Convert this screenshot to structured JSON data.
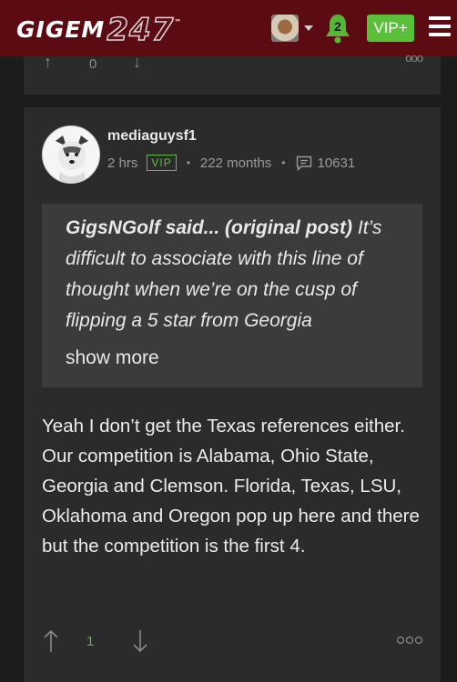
{
  "header": {
    "logo_text": "GIGEM",
    "logo_number": "247",
    "logo_tm": "™",
    "notification_count": "2",
    "vip_label": "VIP+"
  },
  "prev_post": {
    "vote_count": "0"
  },
  "post": {
    "username": "mediaguysf1",
    "time": "2 hrs",
    "badge": "VIP",
    "tenure": "222 months",
    "message_count": "10631",
    "quote": {
      "author": "GigsNGolf said...",
      "tag": "(original post)",
      "text": "It’s difficult to associate with this line of thought when we’re on the cusp of flipping a 5 star from Georgia",
      "show_more": "show more"
    },
    "body": "Yeah I don’t get the Texas references either. Our competition is Alabama, Ohio State, Georgia and Clemson. Florida, Texas, LSU, Oklahoma and Oregon pop up here and there but the competition is the first 4.",
    "vote_count": "1"
  },
  "colors": {
    "header_bg": "#5d0b12",
    "accent_green": "#5bbf3a",
    "page_bg": "#1c1c1c",
    "card_bg": "#2b2b2b",
    "quote_bg": "#3b3b3b"
  },
  "icons": [
    "user-avatar-icon",
    "caret-down-icon",
    "bell-icon",
    "hamburger-menu-icon",
    "upvote-arrow-icon",
    "downvote-arrow-icon",
    "message-icon",
    "more-options-icon"
  ]
}
